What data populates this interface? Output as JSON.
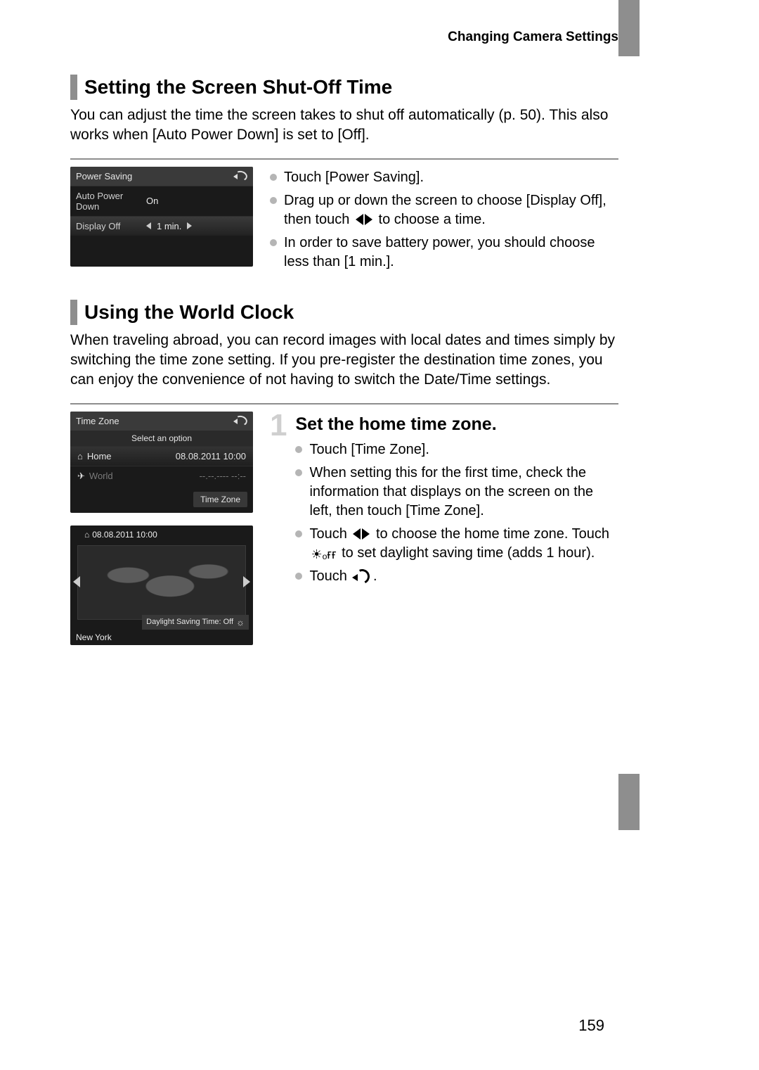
{
  "headerRight": "Changing Camera Settings",
  "pageNumber": "159",
  "section1": {
    "title": "Setting the Screen Shut-Off Time",
    "intro": "You can adjust the time the screen takes to shut off automatically (p. 50). This also works when [Auto Power Down] is set to [Off].",
    "bullets": {
      "b1": "Touch [Power Saving].",
      "b2a": "Drag up or down the screen to choose [Display Off], then touch ",
      "b2b": " to choose a time.",
      "b3": "In order to save battery power, you should choose less than [1 min.]."
    },
    "lcd": {
      "title": "Power Saving",
      "r1label": "Auto Power Down",
      "r1value": "On",
      "r2label": "Display Off",
      "r2value": "1 min."
    }
  },
  "section2": {
    "title": "Using the World Clock",
    "intro": "When traveling abroad, you can record images with local dates and times simply by switching the time zone setting. If you pre-register the destination time zones, you can enjoy the convenience of not having to switch the Date/Time settings.",
    "step1": {
      "num": "1",
      "title": "Set the home time zone.",
      "b1": "Touch [Time Zone].",
      "b2": "When setting this for the first time, check the information that displays on the screen on the left, then touch [Time Zone].",
      "b3a": "Touch ",
      "b3b": " to choose the home time zone. Touch ",
      "b3c": " to set daylight saving time (adds 1 hour).",
      "b4a": "Touch ",
      "b4b": "."
    },
    "lcdTZ": {
      "title": "Time Zone",
      "sub": "Select an option",
      "homeLabel": "Home",
      "homeDate": "08.08.2011 10:00",
      "worldLabel": "World",
      "worldDate": "--.--.---- --:--",
      "btn": "Time Zone"
    },
    "lcdMap": {
      "dt": "08.08.2011 10:00",
      "dst": "Daylight Saving Time: Off",
      "city": "New York"
    }
  },
  "icons": {
    "sunOff": "☀ₒғғ"
  }
}
